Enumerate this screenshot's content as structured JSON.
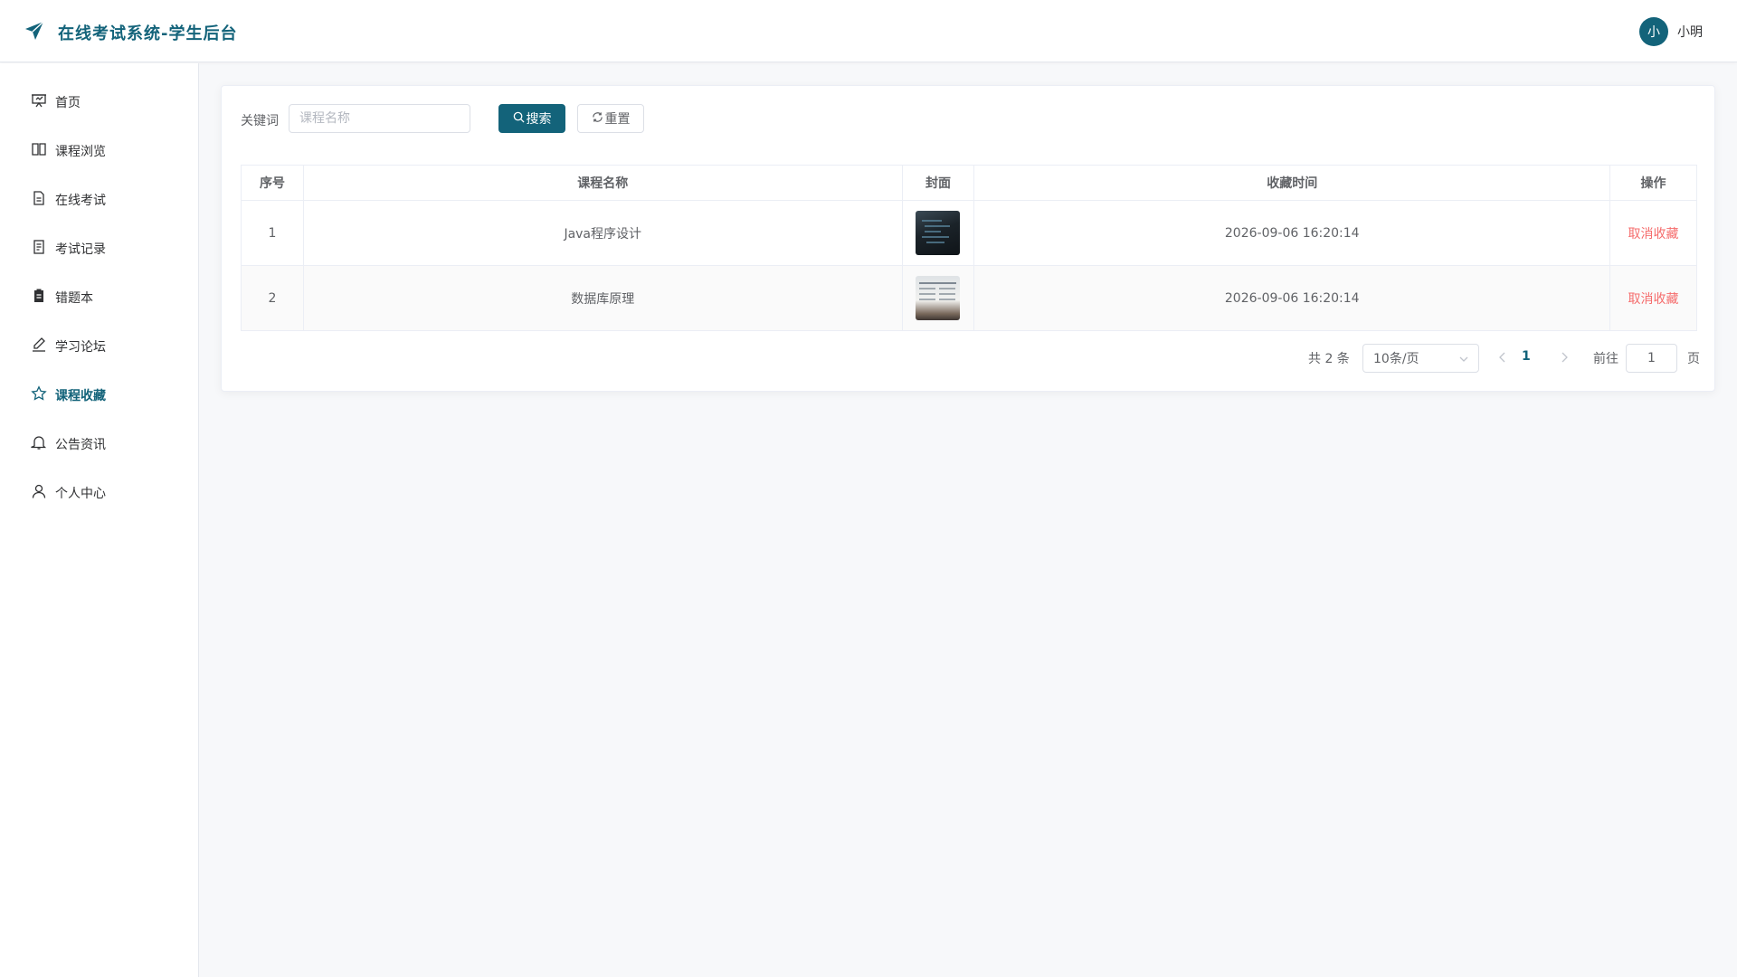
{
  "header": {
    "title": "在线考试系统-学生后台",
    "user": {
      "avatar_text": "小",
      "name": "小明"
    }
  },
  "sidebar": {
    "items": [
      {
        "label": "首页",
        "icon": "presentation-icon",
        "active": false
      },
      {
        "label": "课程浏览",
        "icon": "book-icon",
        "active": false
      },
      {
        "label": "在线考试",
        "icon": "document-icon",
        "active": false
      },
      {
        "label": "考试记录",
        "icon": "list-document-icon",
        "active": false
      },
      {
        "label": "错题本",
        "icon": "clipboard-icon",
        "active": false
      },
      {
        "label": "学习论坛",
        "icon": "pen-icon",
        "active": false
      },
      {
        "label": "课程收藏",
        "icon": "star-icon",
        "active": true
      },
      {
        "label": "公告资讯",
        "icon": "bell-icon",
        "active": false
      },
      {
        "label": "个人中心",
        "icon": "user-icon",
        "active": false
      }
    ]
  },
  "search": {
    "label": "关键词",
    "placeholder": "课程名称",
    "value": "",
    "search_button": "搜索",
    "reset_button": "重置"
  },
  "table": {
    "columns": [
      "序号",
      "课程名称",
      "封面",
      "收藏时间",
      "操作"
    ],
    "rows": [
      {
        "index": "1",
        "name": "Java程序设计",
        "cover": "code-screen-thumbnail",
        "time": "2026-09-06 16:20:14",
        "action": "取消收藏"
      },
      {
        "index": "2",
        "name": "数据库原理",
        "cover": "spreadsheet-screen-thumbnail",
        "time": "2026-09-06 16:20:14",
        "action": "取消收藏"
      }
    ]
  },
  "pagination": {
    "total_text": "共 2 条",
    "page_size": "10条/页",
    "current_page": "1",
    "goto_label": "前往",
    "goto_value": "1",
    "goto_suffix": "页"
  },
  "colors": {
    "primary": "#13637a",
    "danger": "#f56c6c",
    "background": "#f7f8fa"
  }
}
